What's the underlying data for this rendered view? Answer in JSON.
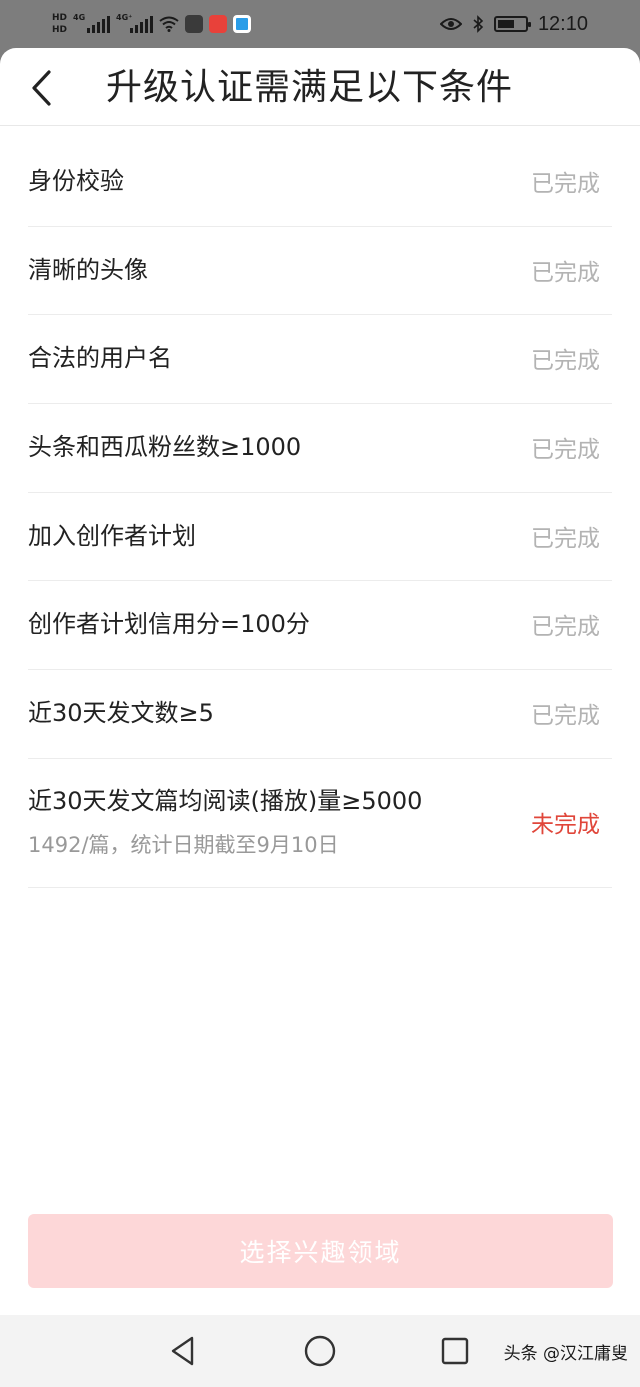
{
  "status_bar": {
    "hd1": "HD",
    "hd2": "HD",
    "sim1_net": "4G",
    "sim2_net": "4G⁺",
    "time": "12:10",
    "battery_percent": 60
  },
  "header": {
    "title": "升级认证需满足以下条件"
  },
  "conditions": [
    {
      "label": "身份校验",
      "status": "已完成"
    },
    {
      "label": "清晰的头像",
      "status": "已完成"
    },
    {
      "label": "合法的用户名",
      "status": "已完成"
    },
    {
      "label": "头条和西瓜粉丝数≥1000",
      "status": "已完成"
    },
    {
      "label": "加入创作者计划",
      "status": "已完成"
    },
    {
      "label": "创作者计划信用分=100分",
      "status": "已完成"
    },
    {
      "label": "近30天发文数≥5",
      "status": "已完成"
    }
  ],
  "pending_condition": {
    "label": "近30天发文篇均阅读(播放)量≥5000",
    "detail": "1492/篇，统计日期截至9月10日",
    "status": "未完成"
  },
  "cta": {
    "label": "选择兴趣领域"
  },
  "watermark": "头条 @汉江庸叟",
  "colors": {
    "incomplete": "#e0463a",
    "complete": "#b3b3b3",
    "cta_bg": "#fdd7d8"
  }
}
